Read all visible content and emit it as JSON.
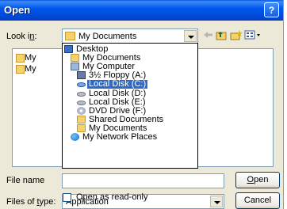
{
  "window": {
    "title": "Open",
    "help_glyph": "?",
    "close_glyph": "×"
  },
  "toolbar": {
    "look_in_label": "Look in:",
    "look_in_value": "My Documents"
  },
  "file_list": {
    "items": [
      "My Mu",
      "My Pic"
    ]
  },
  "dropdown": {
    "items": [
      {
        "label": "Desktop",
        "icon": "desktop-icon",
        "indent": 0
      },
      {
        "label": "My Documents",
        "icon": "folder-icon",
        "indent": 1
      },
      {
        "label": "My Computer",
        "icon": "computer-icon",
        "indent": 1
      },
      {
        "label": "3½ Floppy (A:)",
        "icon": "floppy-icon",
        "indent": 2
      },
      {
        "label": "Local Disk (C:)",
        "icon": "disk-icon",
        "indent": 2,
        "selected": true
      },
      {
        "label": "Local Disk (D:)",
        "icon": "disk-icon",
        "indent": 2
      },
      {
        "label": "Local Disk (E:)",
        "icon": "disk-icon",
        "indent": 2
      },
      {
        "label": "DVD Drive (F:)",
        "icon": "dvd-icon",
        "indent": 2
      },
      {
        "label": "Shared Documents",
        "icon": "folder-icon",
        "indent": 2
      },
      {
        "label": "My Documents",
        "icon": "folder-icon",
        "indent": 2
      },
      {
        "label": "My Network Places",
        "icon": "network-icon",
        "indent": 1
      }
    ]
  },
  "form": {
    "file_name_label": "File name",
    "files_of_type_label": "Files of type:",
    "files_of_type_value": "Application",
    "open_readonly_label": "Open as read-only"
  },
  "buttons": {
    "open": "Open",
    "cancel": "Cancel"
  },
  "colors": {
    "title_bar": "#0058ee",
    "selection": "#316ac5",
    "dialog_bg": "#ece9d8"
  }
}
